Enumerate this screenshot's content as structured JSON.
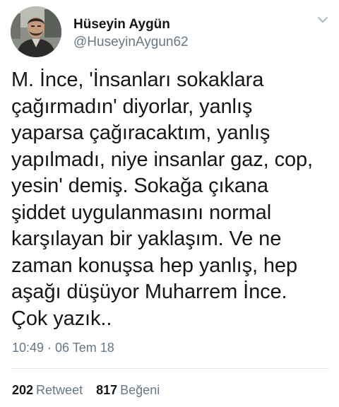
{
  "author": {
    "display_name": "Hüseyin Aygün",
    "handle": "@HuseyinAygun62",
    "avatar_icon": "user-photo-avatar"
  },
  "tweet": {
    "text": "M. İnce, 'İnsanları sokaklara\nçağırmadın' diyorlar, yanlış\nyaparsa çağıracaktım, yanlış\nyapılmadı, niye insanlar gaz, cop,\nyesin' demiş. Sokağa çıkana\nşiddet uygulanmasını normal\nkarşılayan bir yaklaşım. Ve ne\nzaman konuşsa hep yanlış, hep\naşağı düşüyor Muharrem İnce.\nÇok yazık..",
    "timestamp": "10:49 · 06 Tem 18"
  },
  "stats": {
    "retweet_count": "202",
    "retweet_label": "Retweet",
    "like_count": "817",
    "like_label": "Beğeni"
  },
  "icons": {
    "menu": "chevron-down-icon"
  },
  "colors": {
    "text_primary": "#14171a",
    "text_secondary": "#657786",
    "divider": "#e1e8ed",
    "chevron": "#aab8c2"
  }
}
